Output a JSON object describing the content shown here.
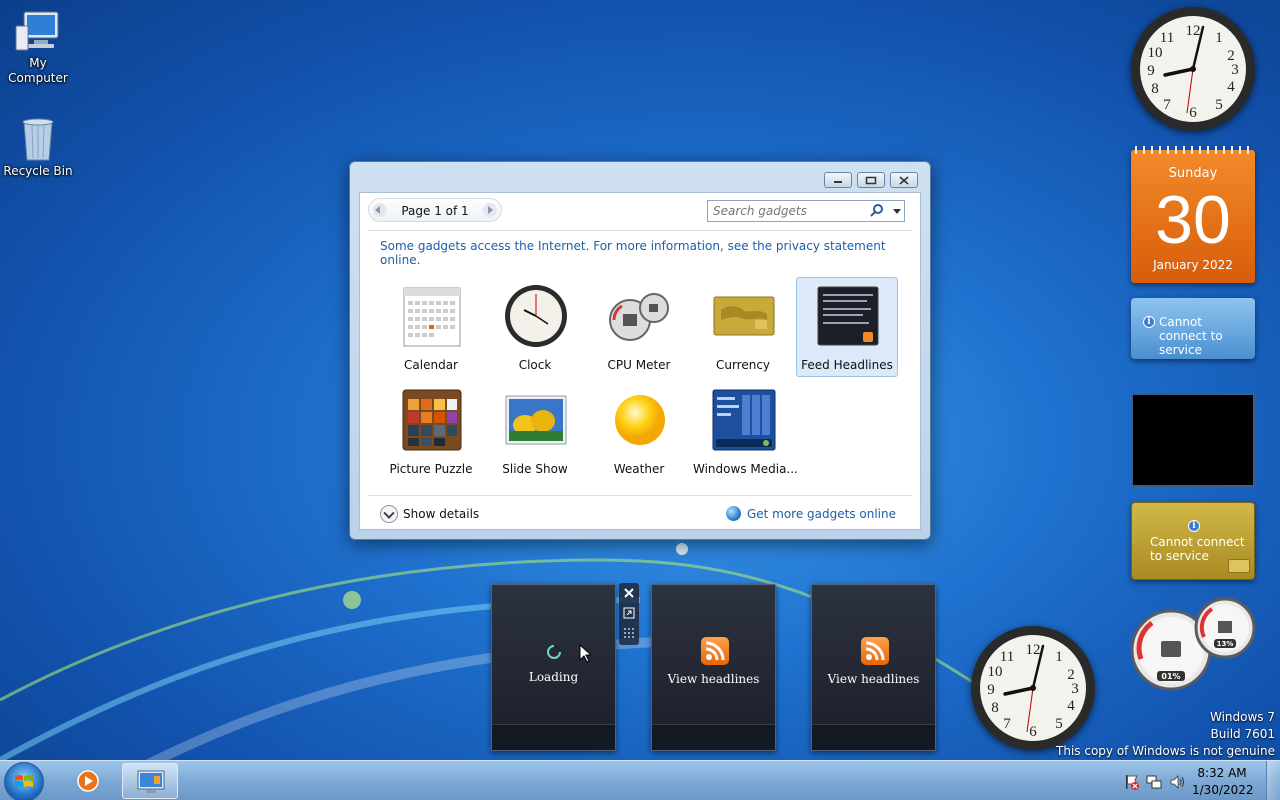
{
  "desktop": {
    "icons": [
      {
        "label": "My Computer"
      },
      {
        "label": "Recycle Bin"
      }
    ]
  },
  "gadget_window": {
    "pager": "Page 1 of 1",
    "search_placeholder": "Search gadgets",
    "notice": "Some gadgets access the Internet.  For more information, see the privacy statement online.",
    "gadgets": [
      {
        "label": "Calendar",
        "selected": false
      },
      {
        "label": "Clock",
        "selected": false
      },
      {
        "label": "CPU Meter",
        "selected": false
      },
      {
        "label": "Currency",
        "selected": false
      },
      {
        "label": "Feed Headlines",
        "selected": true
      },
      {
        "label": "Picture Puzzle",
        "selected": false
      },
      {
        "label": "Slide Show",
        "selected": false
      },
      {
        "label": "Weather",
        "selected": false
      },
      {
        "label": "Windows Media...",
        "selected": false
      }
    ],
    "show_details": "Show details",
    "get_more": "Get more gadgets online"
  },
  "sidebar": {
    "calendar": {
      "day": "Sunday",
      "date": "30",
      "month": "January 2022"
    },
    "weather_error": "Cannot connect to service",
    "currency_error": "Cannot connect to service",
    "cpu": {
      "cpu_percent": "01%",
      "memory_percent": "13%"
    }
  },
  "feed_tiles": [
    {
      "text": "Loading"
    },
    {
      "text": "View headlines"
    },
    {
      "text": "View headlines"
    }
  ],
  "watermark": {
    "line1": "Windows 7",
    "line2": "Build 7601",
    "line3": "This copy of Windows is not genuine"
  },
  "taskbar": {
    "time": "8:32 AM",
    "date": "1/30/2022"
  },
  "colors": {
    "desktop_blue": "#1f72cf",
    "calendar_orange": "#e8650b",
    "link_blue": "#1d5fa8",
    "selection_blue": "#dbe9f8"
  }
}
